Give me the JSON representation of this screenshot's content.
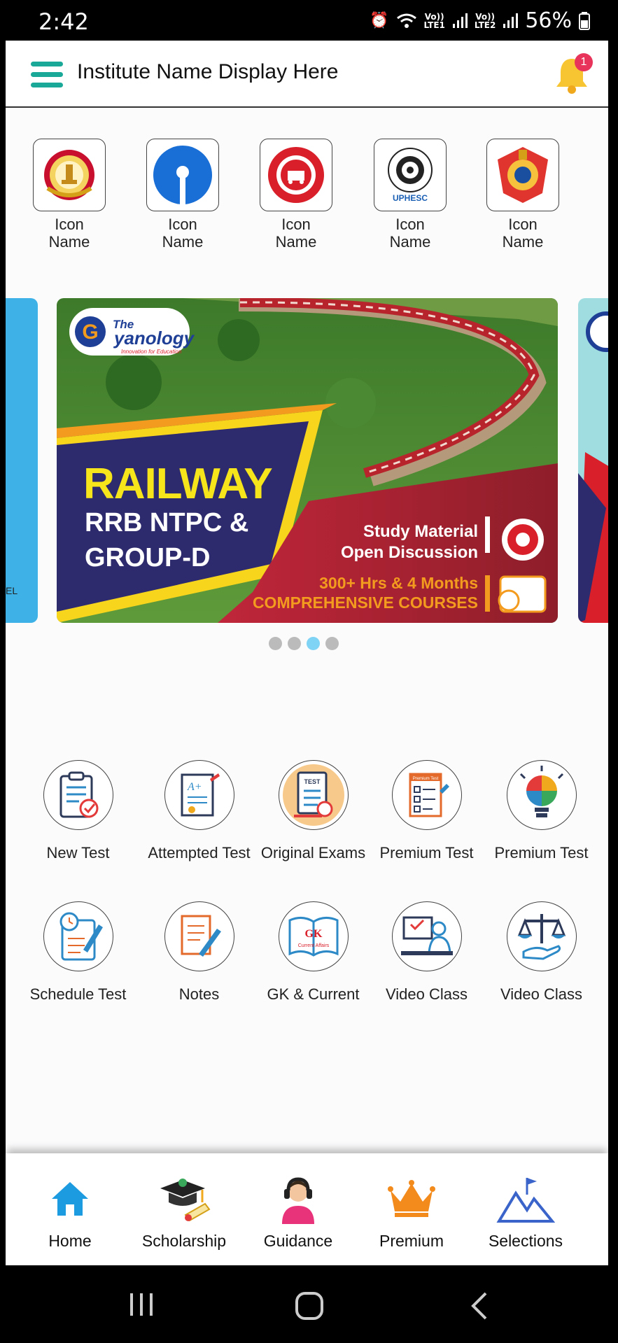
{
  "status_bar": {
    "time": "2:42",
    "battery": "56%",
    "sim1_label": "Vo))\nLTE1",
    "sim2_label": "Vo))\nLTE2"
  },
  "app_bar": {
    "title": "Institute Name Display Here",
    "notification_count": "1",
    "accent_color": "#1aa898",
    "bell_color": "#f7c531"
  },
  "categories": [
    {
      "label": "Icon\nName",
      "icon": "ssc-emblem-icon"
    },
    {
      "label": "Icon\nName",
      "icon": "sbi-logo-icon"
    },
    {
      "label": "Icon\nName",
      "icon": "indian-railways-icon"
    },
    {
      "label": "Icon\nName",
      "icon": "uphesc-icon"
    },
    {
      "label": "Icon\nName",
      "icon": "up-police-icon"
    }
  ],
  "category_texts": {
    "uphesc_badge": "UPHESC"
  },
  "banner": {
    "brand_the": "The",
    "brand_name": "yanology",
    "brand_tagline": "Innovation for Education",
    "headline": "RAILWAY",
    "sub1": "RRB NTPC &",
    "sub2": "GROUP-D",
    "feature1": "Study Material",
    "feature2": "Open Discussion",
    "duration": "300+ Hrs & 4 Months",
    "courses": "COMPREHENSIVE COURSES",
    "left_slide_text": "EL"
  },
  "carousel": {
    "dot_count": 4,
    "active_index": 2
  },
  "grid_row1": [
    {
      "label": "New Test",
      "icon": "clipboard-check-icon"
    },
    {
      "label": "Attempted Test",
      "icon": "graded-paper-icon"
    },
    {
      "label": "Original Exams",
      "icon": "test-clipboard-icon"
    },
    {
      "label": "Premium Test",
      "icon": "premium-test-sheet-icon"
    },
    {
      "label": "Premium Test",
      "icon": "puzzle-bulb-icon"
    }
  ],
  "grid_row2": [
    {
      "label": "Schedule Test",
      "icon": "schedule-clipboard-icon"
    },
    {
      "label": "Notes",
      "icon": "notes-pen-icon"
    },
    {
      "label": "GK & Current",
      "icon": "gk-book-icon"
    },
    {
      "label": "Video Class",
      "icon": "video-class-icon"
    },
    {
      "label": "Video Class",
      "icon": "scales-icon"
    }
  ],
  "grid_texts": {
    "test_label": "TEST",
    "premium_label": "Premium Test",
    "aplus": "A+",
    "gk": "GK",
    "current_affairs": "Current Affairs"
  },
  "bottom_nav": [
    {
      "label": "Home",
      "icon": "home-icon"
    },
    {
      "label": "Scholarship",
      "icon": "graduation-cap-icon"
    },
    {
      "label": "Guidance",
      "icon": "headset-agent-icon"
    },
    {
      "label": "Premium",
      "icon": "crown-icon"
    },
    {
      "label": "Selections",
      "icon": "mountain-flag-icon"
    }
  ],
  "colors": {
    "home_blue": "#1d9be0",
    "premium_orange": "#f28a1c",
    "selections_blue": "#3a64c9",
    "carousel_active_dot": "#7fd3f5"
  }
}
